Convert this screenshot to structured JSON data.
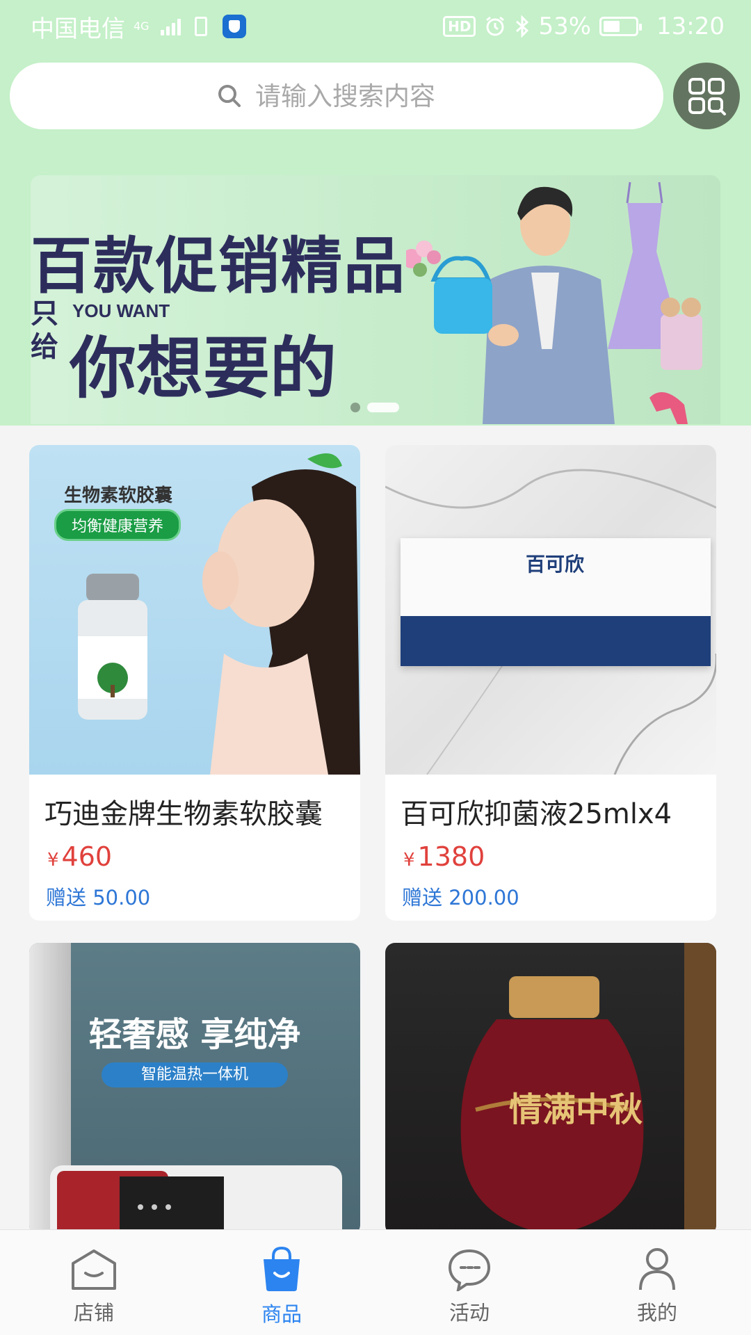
{
  "status_bar": {
    "carrier": "中国电信",
    "network": "4G",
    "hd": "HD",
    "battery": "53%",
    "battery_level": 0.53,
    "time": "13:20"
  },
  "search": {
    "placeholder": "请输入搜索内容"
  },
  "banner": {
    "title": "百款促销精品",
    "side_text": "只给",
    "en_text": "YOU WANT",
    "subtitle": "你想要的",
    "slide_count": 2,
    "active_slide": 1
  },
  "products": [
    {
      "name": "巧迪金牌生物素软胶囊",
      "currency": "¥",
      "price": "460",
      "gift": "赠送 50.00",
      "img_text_1": "生物素软胶囊",
      "img_text_2": "均衡健康营养"
    },
    {
      "name": "百可欣抑菌液25mlx4",
      "currency": "¥",
      "price": "1380",
      "gift": "赠送 200.00",
      "img_text_1": "百可欣"
    },
    {
      "name": "",
      "img_text_1": "轻奢感 享纯净",
      "img_text_2": "智能温热一体机"
    },
    {
      "name": "",
      "img_text_1": "情满中秋"
    }
  ],
  "tabbar": {
    "items": [
      {
        "label": "店铺",
        "icon": "store-icon"
      },
      {
        "label": "商品",
        "icon": "shopping-bag-icon"
      },
      {
        "label": "活动",
        "icon": "chat-bubble-icon"
      },
      {
        "label": "我的",
        "icon": "person-icon"
      }
    ],
    "active_index": 1
  },
  "colors": {
    "header_bg": "#c5f0c9",
    "accent": "#2c84f0",
    "price": "#e0413c",
    "gift": "#2d76d6"
  }
}
